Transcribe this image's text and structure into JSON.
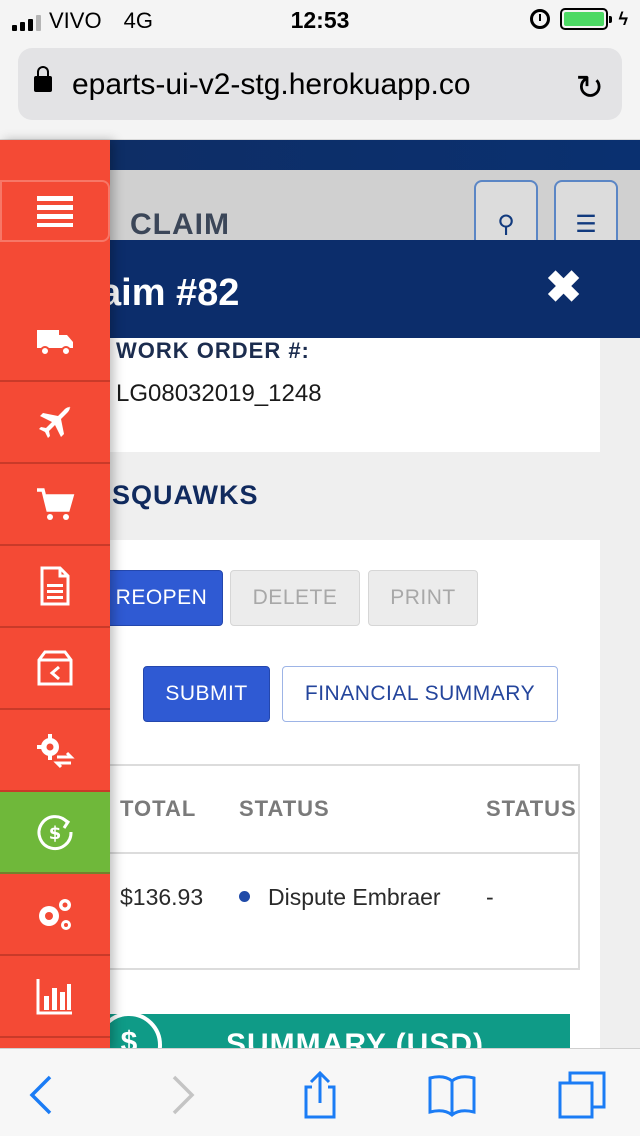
{
  "status_bar": {
    "carrier": "VIVO",
    "network": "4G",
    "time": "12:53",
    "battery_level": 0.9
  },
  "browser": {
    "url": "eparts-ui-v2-stg.herokuapp.co"
  },
  "background_page": {
    "title": "CLAIM"
  },
  "modal": {
    "title": "aim #82",
    "work_order_label": "WORK ORDER #:",
    "work_order_value": "LG08032019_1248",
    "squawks_title": "SQUAWKS",
    "buttons": {
      "reopen": "REOPEN",
      "delete": "DELETE",
      "print": "PRINT",
      "submit": "SUBMIT",
      "financial_summary": "FINANCIAL SUMMARY"
    },
    "table": {
      "headers": [
        "TOTAL",
        "STATUS",
        "STATUS"
      ],
      "rows": [
        {
          "total": "$136.93",
          "status": "Dispute Embraer",
          "status2": "-"
        }
      ]
    },
    "summary_label": "SUMMARY (USD)",
    "summary_coin": "$"
  },
  "sidebar": {
    "colors": {
      "normal": "#f44a35",
      "active": "#6fb83a"
    },
    "items": [
      "menu-icon",
      "truck-icon",
      "airplane-icon",
      "cart-icon",
      "document-icon",
      "return-box-icon",
      "gear-swap-icon",
      "dollar-refresh-icon",
      "gears-icon",
      "bar-chart-icon"
    ],
    "active_item": "dollar-refresh-icon"
  },
  "colors": {
    "navy": "#0c2d6b",
    "primary_button": "#2f5ad3",
    "teal": "#0f9b87",
    "ios_blue": "#1b7cf5"
  }
}
